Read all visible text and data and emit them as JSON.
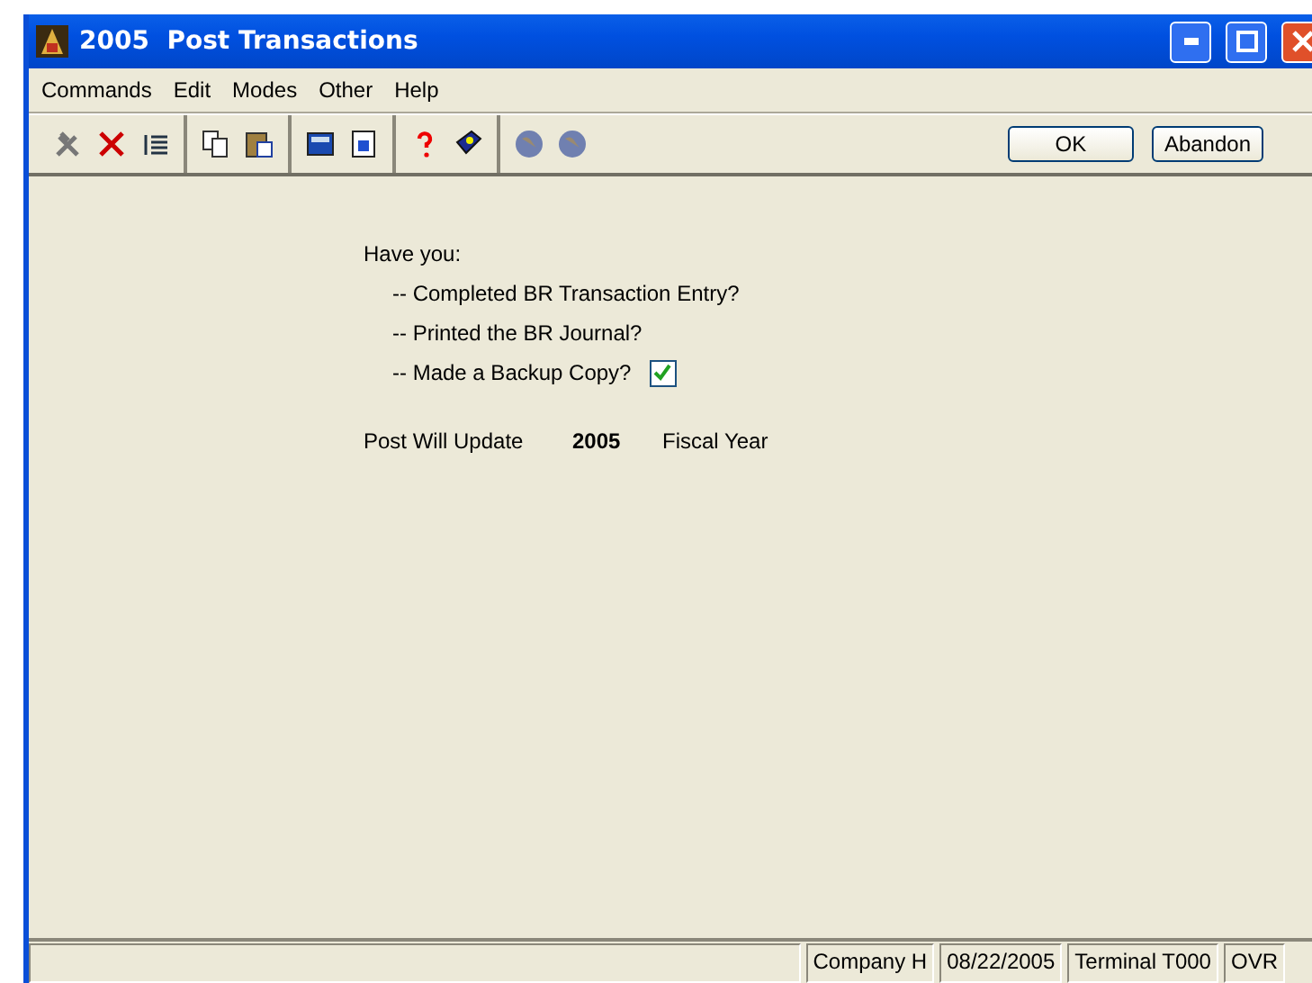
{
  "window": {
    "title": "2005  Post Transactions"
  },
  "menu": [
    "Commands",
    "Edit",
    "Modes",
    "Other",
    "Help"
  ],
  "toolbar": {
    "buttons": [
      "OK",
      "Abandon"
    ]
  },
  "prompt": {
    "heading": "Have you:",
    "items": [
      {
        "kind": "text",
        "label": "-- Completed BR Transaction Entry?"
      },
      {
        "kind": "text",
        "label": "-- Printed the BR Journal?"
      },
      {
        "kind": "checkbox",
        "label": "-- Made a Backup Copy?",
        "checked": true
      }
    ]
  },
  "update": {
    "label": "Post Will Update",
    "year": "2005",
    "suffix": "Fiscal Year"
  },
  "status_bar": [
    "Company H",
    "08/22/2005",
    "Terminal T000",
    "OVR"
  ]
}
